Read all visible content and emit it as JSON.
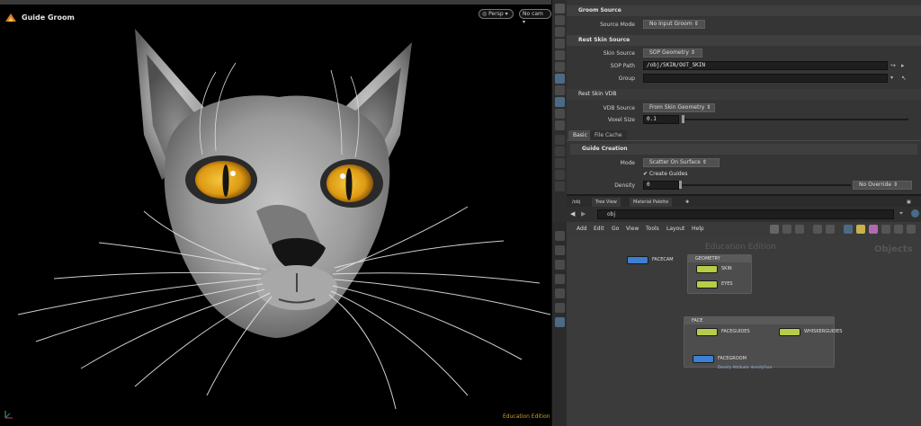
{
  "viewport": {
    "title": "Guide Groom",
    "camera_mode": "Persp",
    "camera": "No cam",
    "edition_label": "Education Edition"
  },
  "params": {
    "groom_source": {
      "title": "Groom Source",
      "source_mode_label": "Source Mode",
      "source_mode_value": "No Input Groom"
    },
    "rest_skin_source": {
      "title": "Rest Skin Source",
      "skin_source_label": "Skin Source",
      "skin_source_value": "SOP Geometry",
      "sop_path_label": "SOP Path",
      "sop_path_value": "/obj/SKIN/OUT_SKIN",
      "group_label": "Group",
      "group_value": ""
    },
    "rest_skin_vdb": {
      "title": "Rest Skin VDB",
      "vdb_source_label": "VDB Source",
      "vdb_source_value": "From Skin Geometry",
      "voxel_size_label": "Voxel Size",
      "voxel_size_value": "0.1"
    },
    "tabs": [
      "Basic",
      "File Cache"
    ],
    "guide_creation": {
      "title": "Guide Creation",
      "mode_label": "Mode",
      "mode_value": "Scatter On Surface",
      "create_guides_label": "Create Guides",
      "create_guides_checked": true,
      "density_label": "Density",
      "density_value": "0",
      "density_override": "No Override"
    }
  },
  "network": {
    "tabs": [
      "/obj",
      "Tree View",
      "Material Palette"
    ],
    "path": "obj",
    "menu": [
      "Add",
      "Edit",
      "Go",
      "View",
      "Tools",
      "Layout",
      "Help"
    ],
    "edition_watermark": "Education Edition",
    "context_label": "Objects",
    "nodes": {
      "facecam": "FACECAM",
      "geometry_box": "GEOMETRY",
      "skin": "SKIN",
      "eyes": "EYES",
      "face_box": "FACE",
      "faceguides": "FACEGUIDES",
      "whiskerguides": "WHISKERGUIDES",
      "facegroom": "FACEGROOM",
      "facegroom_sub": "Density Attribute: densityFace"
    }
  },
  "colors": {
    "eye": "#e0a51c",
    "node_blue": "#3d7fd1",
    "node_yellow_green": "#b8cc4a",
    "edu_gold": "#c9a42a"
  }
}
